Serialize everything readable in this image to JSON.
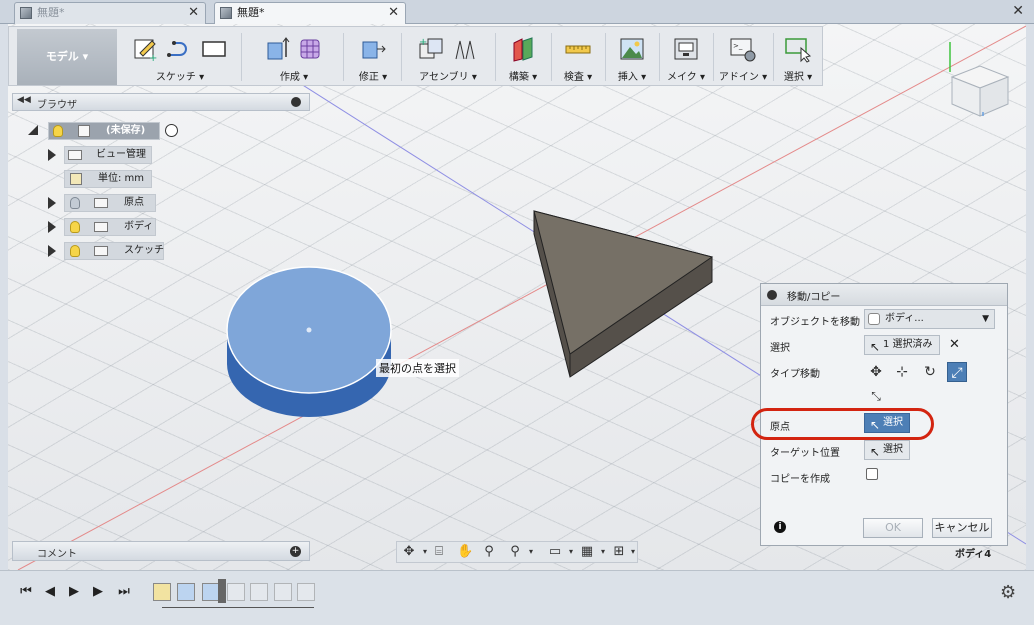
{
  "tabs": [
    {
      "label": "無題*",
      "active": false
    },
    {
      "label": "無題*",
      "active": true
    }
  ],
  "toolbar": {
    "workspace": "モデル ▾",
    "groups": [
      {
        "label": "スケッチ ▾"
      },
      {
        "label": "作成 ▾"
      },
      {
        "label": "修正 ▾"
      },
      {
        "label": "アセンブリ ▾"
      },
      {
        "label": "構築 ▾"
      },
      {
        "label": "検査 ▾"
      },
      {
        "label": "挿入 ▾"
      },
      {
        "label": "メイク ▾"
      },
      {
        "label": "アドイン ▾"
      },
      {
        "label": "選択 ▾"
      }
    ]
  },
  "browser": {
    "title": "ブラウザ",
    "root": "(未保存)",
    "items": [
      {
        "label": "ビュー管理"
      },
      {
        "label": "単位: mm"
      },
      {
        "label": "原点"
      },
      {
        "label": "ボディ"
      },
      {
        "label": "スケッチ"
      }
    ]
  },
  "canvas": {
    "tooltip": "最初の点を選択",
    "body_label": "ボディ4"
  },
  "comment": {
    "title": "コメント"
  },
  "dialog": {
    "title": "移動/コピー",
    "rows": {
      "object_label": "オブジェクトを移動",
      "object_value": "ボディ...",
      "select_label": "選択",
      "select_value": "1 選択済み",
      "type_label": "タイプ移動",
      "origin_label": "原点",
      "origin_value": "選択",
      "target_label": "ターゲット位置",
      "target_value": "選択",
      "copy_label": "コピーを作成"
    },
    "ok": "OK",
    "cancel": "キャンセル"
  },
  "colors": {
    "accent": "#4d7fb6",
    "highlight": "#d32410",
    "cylinder_top": "#7fa6d9",
    "cylinder_side": "#3566b0",
    "prism_face": "#767066"
  }
}
